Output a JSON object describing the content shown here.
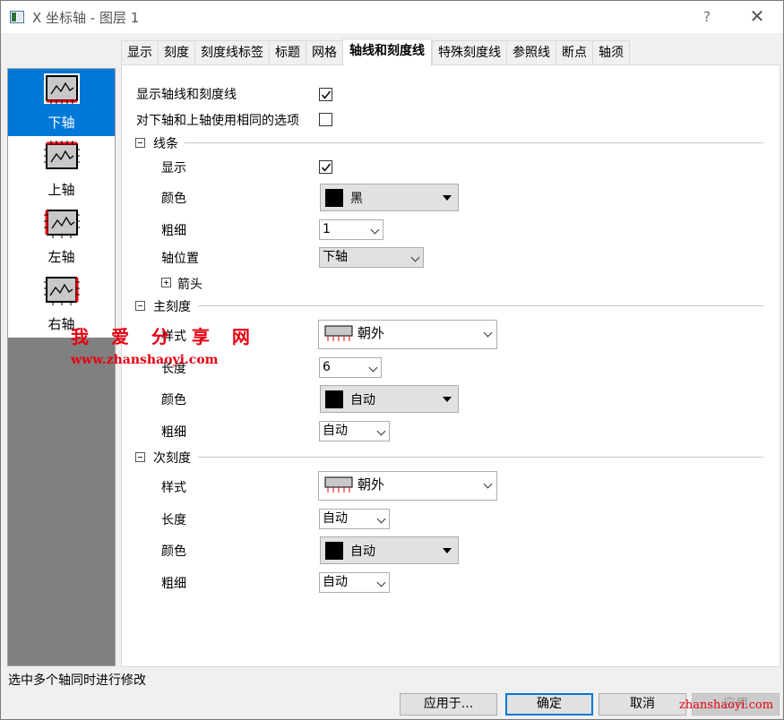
{
  "window": {
    "title": "X 坐标轴 - 图层 1",
    "help_label": "?",
    "close_label": "✕"
  },
  "tabs": [
    {
      "label": "显示",
      "active": false
    },
    {
      "label": "刻度",
      "active": false
    },
    {
      "label": "刻度线标签",
      "active": false
    },
    {
      "label": "标题",
      "active": false
    },
    {
      "label": "网格",
      "active": false
    },
    {
      "label": "轴线和刻度线",
      "active": true
    },
    {
      "label": "特殊刻度线",
      "active": false
    },
    {
      "label": "参照线",
      "active": false
    },
    {
      "label": "断点",
      "active": false
    },
    {
      "label": "轴须",
      "active": false
    }
  ],
  "axes": [
    {
      "label": "下轴",
      "selected": true,
      "icon": "bottom-axis-icon"
    },
    {
      "label": "上轴",
      "selected": false,
      "icon": "top-axis-icon"
    },
    {
      "label": "左轴",
      "selected": false,
      "icon": "left-axis-icon"
    },
    {
      "label": "右轴",
      "selected": false,
      "icon": "right-axis-icon"
    }
  ],
  "options": {
    "show_axis_ticks_label": "显示轴线和刻度线",
    "show_axis_ticks_checked": true,
    "same_options_label": "对下轴和上轴使用相同的选项",
    "same_options_checked": false
  },
  "line_section": {
    "title": "线条",
    "show_label": "显示",
    "show_checked": true,
    "color_label": "颜色",
    "color_value": "黑",
    "thickness_label": "粗细",
    "thickness_value": "1",
    "position_label": "轴位置",
    "position_value": "下轴",
    "arrow_label": "箭头"
  },
  "major_section": {
    "title": "主刻度",
    "style_label": "样式",
    "style_value": "朝外",
    "length_label": "长度",
    "length_value": "6",
    "color_label": "颜色",
    "color_value": "自动",
    "thickness_label": "粗细",
    "thickness_value": "自动"
  },
  "minor_section": {
    "title": "次刻度",
    "style_label": "样式",
    "style_value": "朝外",
    "length_label": "长度",
    "length_value": "自动",
    "color_label": "颜色",
    "color_value": "自动",
    "thickness_label": "粗细",
    "thickness_value": "自动"
  },
  "status": {
    "text": "选中多个轴同时进行修改"
  },
  "buttons": {
    "apply_to": "应用于...",
    "ok": "确定",
    "cancel": "取消",
    "apply": "应用"
  },
  "watermark": {
    "title": "我 爱 分 享 网",
    "url": "www.zhanshaoyi.com",
    "corner": "zhanshaoyi.com"
  },
  "colors": {
    "selection": "#0078d7",
    "watermark": "#e60012",
    "swatch": "#000000"
  }
}
